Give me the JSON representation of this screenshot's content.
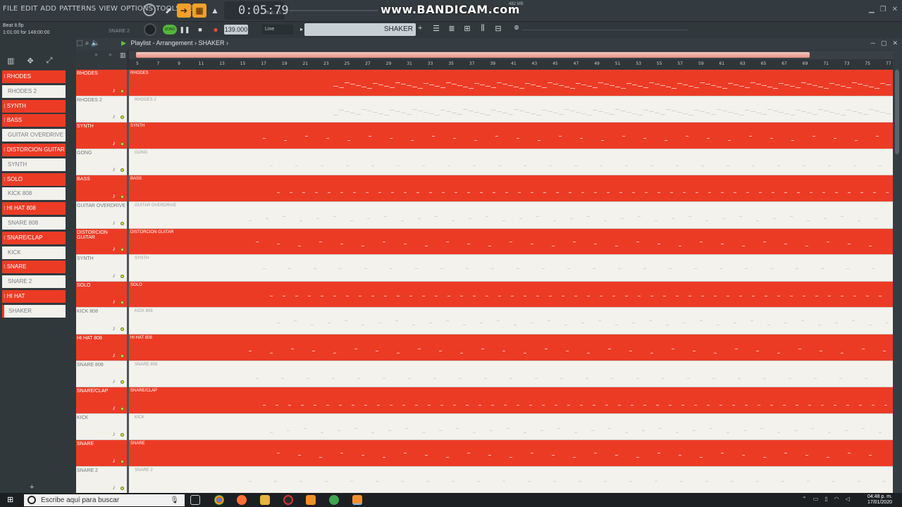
{
  "menu": [
    "FILE",
    "EDIT",
    "ADD",
    "PATTERNS",
    "VIEW",
    "OPTIONS",
    "TOOLS",
    "HELP"
  ],
  "time": "0:05:79",
  "time_unit": "M:S:CS",
  "watermark": "www.BANDICAM.com",
  "memory": "482 MB",
  "hint_line1": "Beat It.flp",
  "hint_line2": "1:01:00 for 148:00:00",
  "hint_right": "SNARE 2",
  "song_label": "SONG",
  "tempo": "139.000",
  "snap": "Line",
  "pattern": "SHAKER",
  "breadcrumb": "Playlist - Arrangement",
  "breadcrumb_sep": "›",
  "breadcrumb_pattern": "SHAKER",
  "picker": [
    {
      "label": "RHODES",
      "style": "red"
    },
    {
      "label": "RHODES 2",
      "style": "white"
    },
    {
      "label": "SYNTH",
      "style": "red"
    },
    {
      "label": "BASS",
      "style": "red"
    },
    {
      "label": "GUITAR OVERDRIVE",
      "style": "white"
    },
    {
      "label": "DISTORCION GUITAR",
      "style": "red"
    },
    {
      "label": "SYNTH",
      "style": "white"
    },
    {
      "label": "SOLO",
      "style": "red"
    },
    {
      "label": "KICK 808",
      "style": "white"
    },
    {
      "label": "HI HAT 808",
      "style": "red"
    },
    {
      "label": "SNARE 808",
      "style": "white"
    },
    {
      "label": "SNARE/CLAP",
      "style": "red"
    },
    {
      "label": "KICK",
      "style": "white"
    },
    {
      "label": "SNARE",
      "style": "red"
    },
    {
      "label": "SNARE 2",
      "style": "white"
    },
    {
      "label": "HI HAT",
      "style": "red"
    },
    {
      "label": "SHAKER",
      "style": "white",
      "selected": true
    }
  ],
  "tracks": [
    {
      "name": "RHODES",
      "clip": "RHODES",
      "style": "red"
    },
    {
      "name": "RHODES 2",
      "clip": "RHODES 2",
      "style": "white"
    },
    {
      "name": "SYNTH",
      "clip": "SYNTH",
      "style": "red"
    },
    {
      "name": "GONG",
      "clip": "GONG",
      "style": "white"
    },
    {
      "name": "BASS",
      "clip": "BASS",
      "style": "red"
    },
    {
      "name": "GUITAR OVERDRIVE",
      "clip": "GUITAR OVERDRIVE",
      "style": "white"
    },
    {
      "name": "DISTORCION GUITAR",
      "clip": "DISTORCION GUITAR",
      "style": "red"
    },
    {
      "name": "SYNTH",
      "clip": "SYNTH",
      "style": "white"
    },
    {
      "name": "SOLO",
      "clip": "SOLO",
      "style": "red"
    },
    {
      "name": "KICK 808",
      "clip": "KICK 808",
      "style": "white"
    },
    {
      "name": "HI HAT 808",
      "clip": "HI HAT 808",
      "style": "red"
    },
    {
      "name": "SNARE 808",
      "clip": "SNARE 808",
      "style": "white"
    },
    {
      "name": "SNARE/CLAP",
      "clip": "SNARE/CLAP",
      "style": "red"
    },
    {
      "name": "KICK",
      "clip": "KICK",
      "style": "white"
    },
    {
      "name": "SNARE",
      "clip": "SNARE",
      "style": "red"
    },
    {
      "name": "SNARE 2",
      "clip": "SNARE 2",
      "style": "white"
    }
  ],
  "ruler": [
    "5",
    "7",
    "9",
    "11",
    "13",
    "15",
    "17",
    "19",
    "21",
    "23",
    "25",
    "27",
    "29",
    "31",
    "33",
    "35",
    "37",
    "39",
    "41",
    "43",
    "45",
    "47",
    "49",
    "51",
    "53",
    "55",
    "57",
    "59",
    "61",
    "63",
    "65",
    "67",
    "69",
    "71",
    "73",
    "75",
    "77"
  ],
  "taskbar": {
    "search_placeholder": "Escribe aquí para buscar",
    "clock_time": "04:48 p. m.",
    "clock_date": "17/01/2020"
  },
  "colors": {
    "accent_red": "#ec3b25",
    "lane_white": "#f4f2ec",
    "song_green": "#52b63c"
  }
}
